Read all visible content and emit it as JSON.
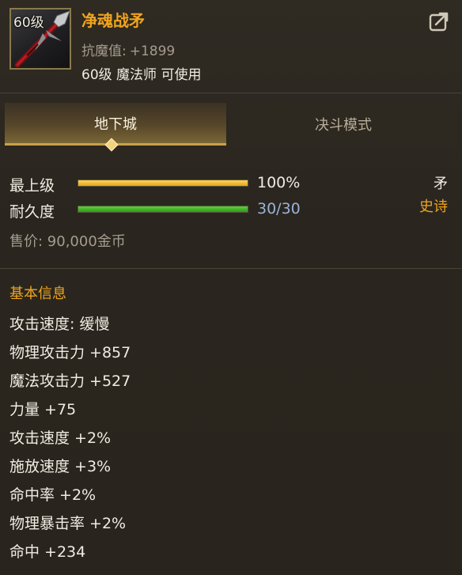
{
  "item": {
    "level_tag": "60级",
    "name": "净魂战矛",
    "stat_label": "抗魔值:",
    "stat_value": "+1899",
    "requirement": "60级 魔法师 可使用",
    "icon": "spear-icon",
    "share_icon": "share-icon"
  },
  "tabs": [
    {
      "label": "地下城",
      "active": true
    },
    {
      "label": "决斗模式",
      "active": false
    }
  ],
  "bars": {
    "grade": {
      "label": "最上级",
      "value_text": "100%",
      "fraction": 1.0,
      "color": "#f0b52a"
    },
    "durability": {
      "label": "耐久度",
      "value_text": "30/30",
      "fraction": 1.0,
      "color": "#3cb526"
    }
  },
  "type": "矛",
  "rarity": "史诗",
  "price": "售价: 90,000金币",
  "basic_info": {
    "title": "基本信息",
    "lines": [
      "攻击速度: 缓慢",
      "物理攻击力 +857",
      "魔法攻击力 +527",
      "力量 +75",
      "攻击速度 +2%",
      "施放速度 +3%",
      "命中率 +2%",
      "物理暴击率 +2%",
      "命中 +234"
    ]
  },
  "colors": {
    "accent_orange": "#f0a41e",
    "muted_text": "#a59c8e",
    "durability_value": "#9ab3d6"
  }
}
